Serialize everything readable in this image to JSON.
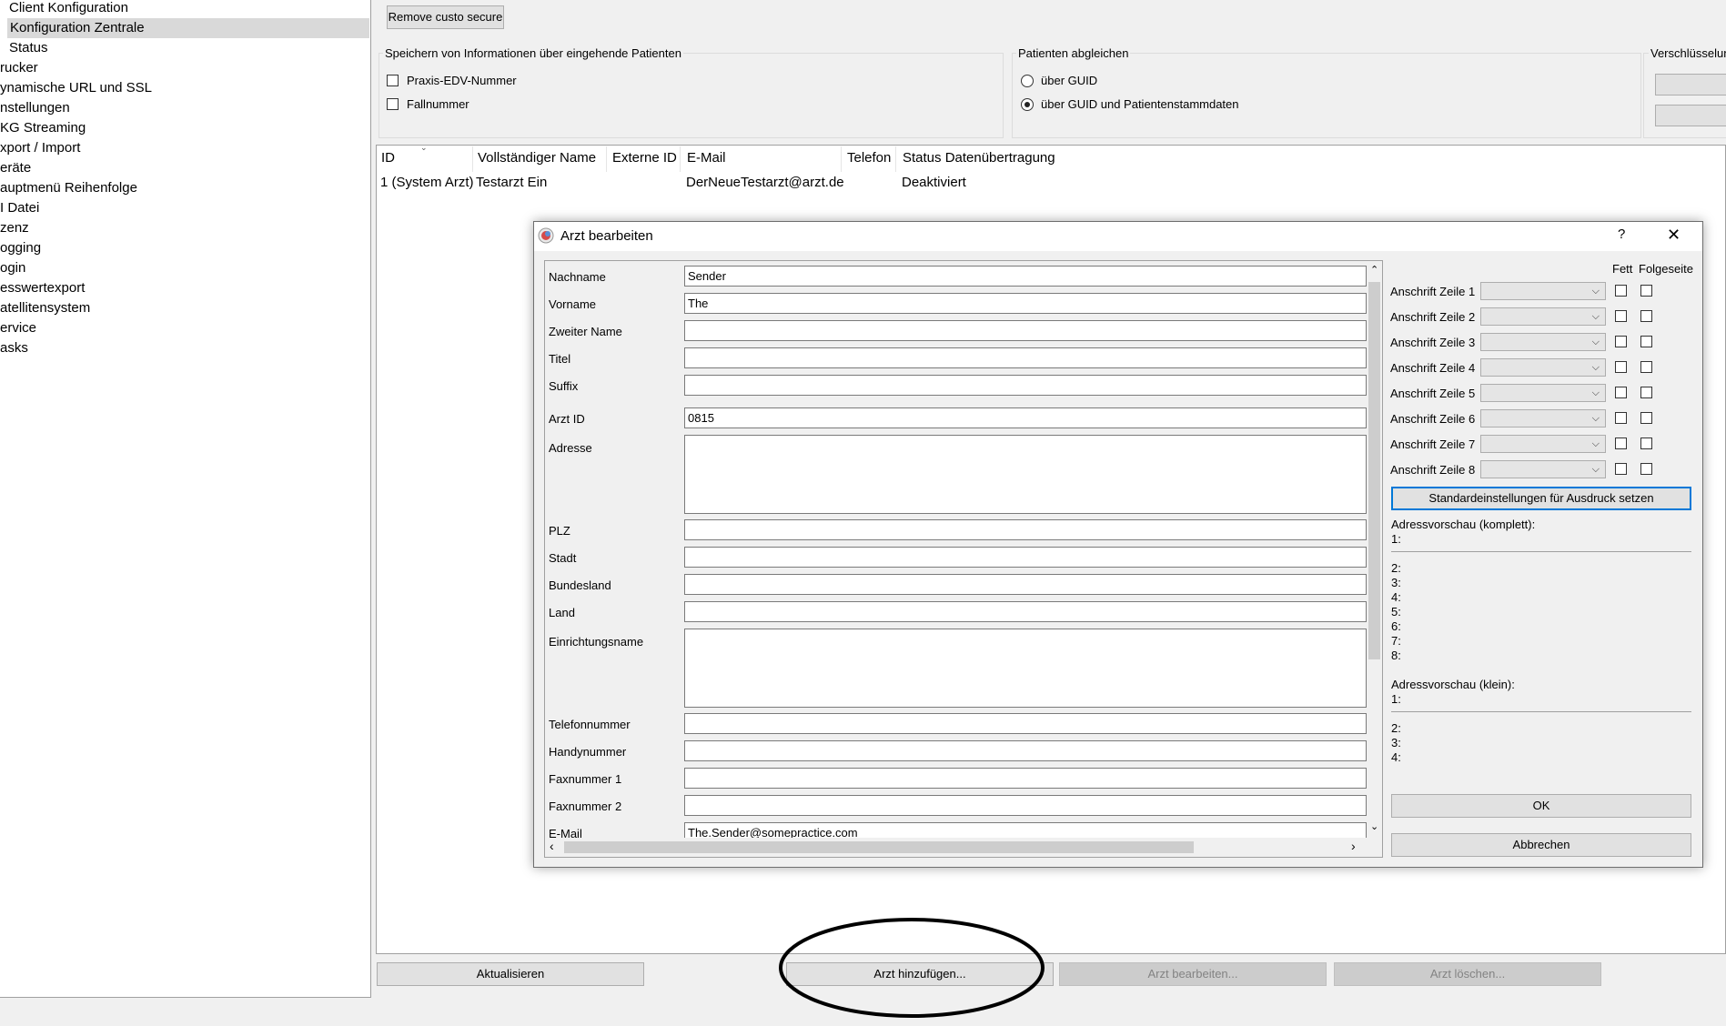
{
  "tree": {
    "items": [
      "Client Konfiguration",
      "Konfiguration Zentrale",
      "Status",
      "rucker",
      "ynamische URL und SSL",
      "nstellungen",
      "KG Streaming",
      "xport / Import",
      "eräte",
      "auptmenü Reihenfolge",
      "I Datei",
      "zenz",
      "ogging",
      "ogin",
      "esswertexport",
      "atellitensystem",
      "ervice",
      "asks"
    ]
  },
  "top": {
    "remove_button": "Remove custo secure",
    "save_group_title": "Speichern von Informationen über eingehende Patienten",
    "chk_praxis": "Praxis-EDV-Nummer",
    "chk_fall": "Fallnummer",
    "match_group_title": "Patienten abgleichen",
    "radio_guid": "über GUID",
    "radio_guid_stamm": "über GUID und Patientenstammdaten",
    "enc_group_title": "Verschlüsselun"
  },
  "table": {
    "headers": [
      "ID",
      "Vollständiger Name",
      "Externe ID",
      "E-Mail",
      "Telefon",
      "Status Datenübertragung"
    ],
    "row": [
      "1 (System Arzt)",
      "Testarzt Ein",
      "",
      "DerNeueTestarzt@arzt.de",
      "",
      "Deaktiviert"
    ]
  },
  "bottom": {
    "refresh": "Aktualisieren",
    "add": "Arzt hinzufügen...",
    "edit": "Arzt bearbeiten...",
    "delete": "Arzt löschen..."
  },
  "dialog": {
    "title": "Arzt bearbeiten",
    "help": "?",
    "close": "✕",
    "fields": {
      "nachname": {
        "label": "Nachname",
        "value": "Sender"
      },
      "vorname": {
        "label": "Vorname",
        "value": "The"
      },
      "zweiter": {
        "label": "Zweiter Name",
        "value": ""
      },
      "titel": {
        "label": "Titel",
        "value": ""
      },
      "suffix": {
        "label": "Suffix",
        "value": ""
      },
      "arztid": {
        "label": "Arzt ID",
        "value": "0815"
      },
      "adresse": {
        "label": "Adresse",
        "value": ""
      },
      "plz": {
        "label": "PLZ",
        "value": ""
      },
      "stadt": {
        "label": "Stadt",
        "value": ""
      },
      "bundesland": {
        "label": "Bundesland",
        "value": ""
      },
      "land": {
        "label": "Land",
        "value": ""
      },
      "einrichtung": {
        "label": "Einrichtungsname",
        "value": ""
      },
      "telefon": {
        "label": "Telefonnummer",
        "value": ""
      },
      "handy": {
        "label": "Handynummer",
        "value": ""
      },
      "fax1": {
        "label": "Faxnummer 1",
        "value": ""
      },
      "fax2": {
        "label": "Faxnummer 2",
        "value": ""
      },
      "email": {
        "label": "E-Mail",
        "value": "The.Sender@somepractice.com"
      }
    },
    "right": {
      "fett": "Fett",
      "folgeseite": "Folgeseite",
      "lines": [
        "Anschrift Zeile 1",
        "Anschrift Zeile 2",
        "Anschrift Zeile 3",
        "Anschrift Zeile 4",
        "Anschrift Zeile 5",
        "Anschrift Zeile 6",
        "Anschrift Zeile 7",
        "Anschrift Zeile 8"
      ],
      "defaults_button": "Standardeinstellungen für Ausdruck setzen",
      "preview_full_title": "Adressvorschau (komplett):",
      "preview_full": [
        "1:",
        "2:",
        "3:",
        "4:",
        "5:",
        "6:",
        "7:",
        "8:"
      ],
      "preview_small_title": "Adressvorschau (klein):",
      "preview_small": [
        "1:",
        "2:",
        "3:",
        "4:"
      ],
      "ok": "OK",
      "cancel": "Abbrechen"
    }
  }
}
